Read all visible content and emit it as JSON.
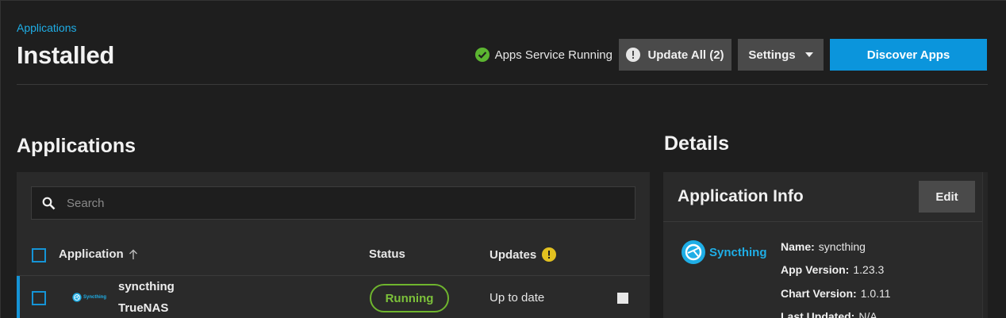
{
  "header": {
    "breadcrumb": "Applications",
    "title": "Installed",
    "service_status": "Apps Service Running",
    "update_all_label": "Update All (2)",
    "settings_label": "Settings",
    "discover_label": "Discover Apps"
  },
  "applications": {
    "title": "Applications",
    "search_placeholder": "Search",
    "columns": {
      "application": "Application",
      "status": "Status",
      "updates": "Updates"
    },
    "rows": [
      {
        "logo_text": "Syncthing",
        "name": "syncthing",
        "train": "TrueNAS",
        "status": "Running",
        "updates": "Up to date"
      }
    ]
  },
  "details": {
    "title": "Details",
    "card_title": "Application Info",
    "edit_label": "Edit",
    "logo_text": "Syncthing",
    "fields": {
      "name_label": "Name:",
      "name_value": "syncthing",
      "app_version_label": "App Version:",
      "app_version_value": "1.23.3",
      "chart_version_label": "Chart Version:",
      "chart_version_value": "1.0.11",
      "last_updated_label": "Last Updated:",
      "last_updated_value": "N/A"
    }
  },
  "colors": {
    "accent": "#0b95dc",
    "link": "#1faee6",
    "running": "#7cc13a",
    "warning": "#e2c120",
    "success": "#5cb531"
  }
}
